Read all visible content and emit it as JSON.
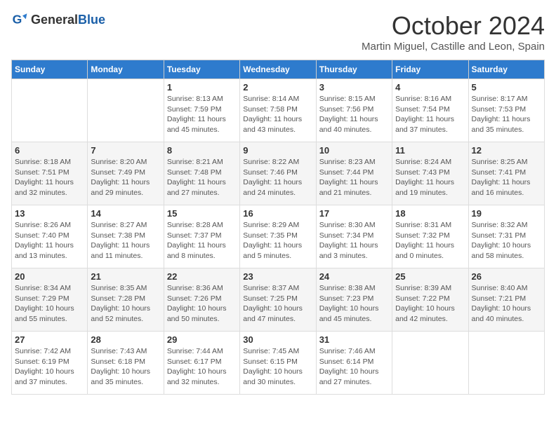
{
  "header": {
    "logo_general": "General",
    "logo_blue": "Blue",
    "month_title": "October 2024",
    "subtitle": "Martin Miguel, Castille and Leon, Spain"
  },
  "calendar": {
    "days_of_week": [
      "Sunday",
      "Monday",
      "Tuesday",
      "Wednesday",
      "Thursday",
      "Friday",
      "Saturday"
    ],
    "weeks": [
      [
        {
          "day": "",
          "info": ""
        },
        {
          "day": "",
          "info": ""
        },
        {
          "day": "1",
          "info": "Sunrise: 8:13 AM\nSunset: 7:59 PM\nDaylight: 11 hours and 45 minutes."
        },
        {
          "day": "2",
          "info": "Sunrise: 8:14 AM\nSunset: 7:58 PM\nDaylight: 11 hours and 43 minutes."
        },
        {
          "day": "3",
          "info": "Sunrise: 8:15 AM\nSunset: 7:56 PM\nDaylight: 11 hours and 40 minutes."
        },
        {
          "day": "4",
          "info": "Sunrise: 8:16 AM\nSunset: 7:54 PM\nDaylight: 11 hours and 37 minutes."
        },
        {
          "day": "5",
          "info": "Sunrise: 8:17 AM\nSunset: 7:53 PM\nDaylight: 11 hours and 35 minutes."
        }
      ],
      [
        {
          "day": "6",
          "info": "Sunrise: 8:18 AM\nSunset: 7:51 PM\nDaylight: 11 hours and 32 minutes."
        },
        {
          "day": "7",
          "info": "Sunrise: 8:20 AM\nSunset: 7:49 PM\nDaylight: 11 hours and 29 minutes."
        },
        {
          "day": "8",
          "info": "Sunrise: 8:21 AM\nSunset: 7:48 PM\nDaylight: 11 hours and 27 minutes."
        },
        {
          "day": "9",
          "info": "Sunrise: 8:22 AM\nSunset: 7:46 PM\nDaylight: 11 hours and 24 minutes."
        },
        {
          "day": "10",
          "info": "Sunrise: 8:23 AM\nSunset: 7:44 PM\nDaylight: 11 hours and 21 minutes."
        },
        {
          "day": "11",
          "info": "Sunrise: 8:24 AM\nSunset: 7:43 PM\nDaylight: 11 hours and 19 minutes."
        },
        {
          "day": "12",
          "info": "Sunrise: 8:25 AM\nSunset: 7:41 PM\nDaylight: 11 hours and 16 minutes."
        }
      ],
      [
        {
          "day": "13",
          "info": "Sunrise: 8:26 AM\nSunset: 7:40 PM\nDaylight: 11 hours and 13 minutes."
        },
        {
          "day": "14",
          "info": "Sunrise: 8:27 AM\nSunset: 7:38 PM\nDaylight: 11 hours and 11 minutes."
        },
        {
          "day": "15",
          "info": "Sunrise: 8:28 AM\nSunset: 7:37 PM\nDaylight: 11 hours and 8 minutes."
        },
        {
          "day": "16",
          "info": "Sunrise: 8:29 AM\nSunset: 7:35 PM\nDaylight: 11 hours and 5 minutes."
        },
        {
          "day": "17",
          "info": "Sunrise: 8:30 AM\nSunset: 7:34 PM\nDaylight: 11 hours and 3 minutes."
        },
        {
          "day": "18",
          "info": "Sunrise: 8:31 AM\nSunset: 7:32 PM\nDaylight: 11 hours and 0 minutes."
        },
        {
          "day": "19",
          "info": "Sunrise: 8:32 AM\nSunset: 7:31 PM\nDaylight: 10 hours and 58 minutes."
        }
      ],
      [
        {
          "day": "20",
          "info": "Sunrise: 8:34 AM\nSunset: 7:29 PM\nDaylight: 10 hours and 55 minutes."
        },
        {
          "day": "21",
          "info": "Sunrise: 8:35 AM\nSunset: 7:28 PM\nDaylight: 10 hours and 52 minutes."
        },
        {
          "day": "22",
          "info": "Sunrise: 8:36 AM\nSunset: 7:26 PM\nDaylight: 10 hours and 50 minutes."
        },
        {
          "day": "23",
          "info": "Sunrise: 8:37 AM\nSunset: 7:25 PM\nDaylight: 10 hours and 47 minutes."
        },
        {
          "day": "24",
          "info": "Sunrise: 8:38 AM\nSunset: 7:23 PM\nDaylight: 10 hours and 45 minutes."
        },
        {
          "day": "25",
          "info": "Sunrise: 8:39 AM\nSunset: 7:22 PM\nDaylight: 10 hours and 42 minutes."
        },
        {
          "day": "26",
          "info": "Sunrise: 8:40 AM\nSunset: 7:21 PM\nDaylight: 10 hours and 40 minutes."
        }
      ],
      [
        {
          "day": "27",
          "info": "Sunrise: 7:42 AM\nSunset: 6:19 PM\nDaylight: 10 hours and 37 minutes."
        },
        {
          "day": "28",
          "info": "Sunrise: 7:43 AM\nSunset: 6:18 PM\nDaylight: 10 hours and 35 minutes."
        },
        {
          "day": "29",
          "info": "Sunrise: 7:44 AM\nSunset: 6:17 PM\nDaylight: 10 hours and 32 minutes."
        },
        {
          "day": "30",
          "info": "Sunrise: 7:45 AM\nSunset: 6:15 PM\nDaylight: 10 hours and 30 minutes."
        },
        {
          "day": "31",
          "info": "Sunrise: 7:46 AM\nSunset: 6:14 PM\nDaylight: 10 hours and 27 minutes."
        },
        {
          "day": "",
          "info": ""
        },
        {
          "day": "",
          "info": ""
        }
      ]
    ]
  }
}
